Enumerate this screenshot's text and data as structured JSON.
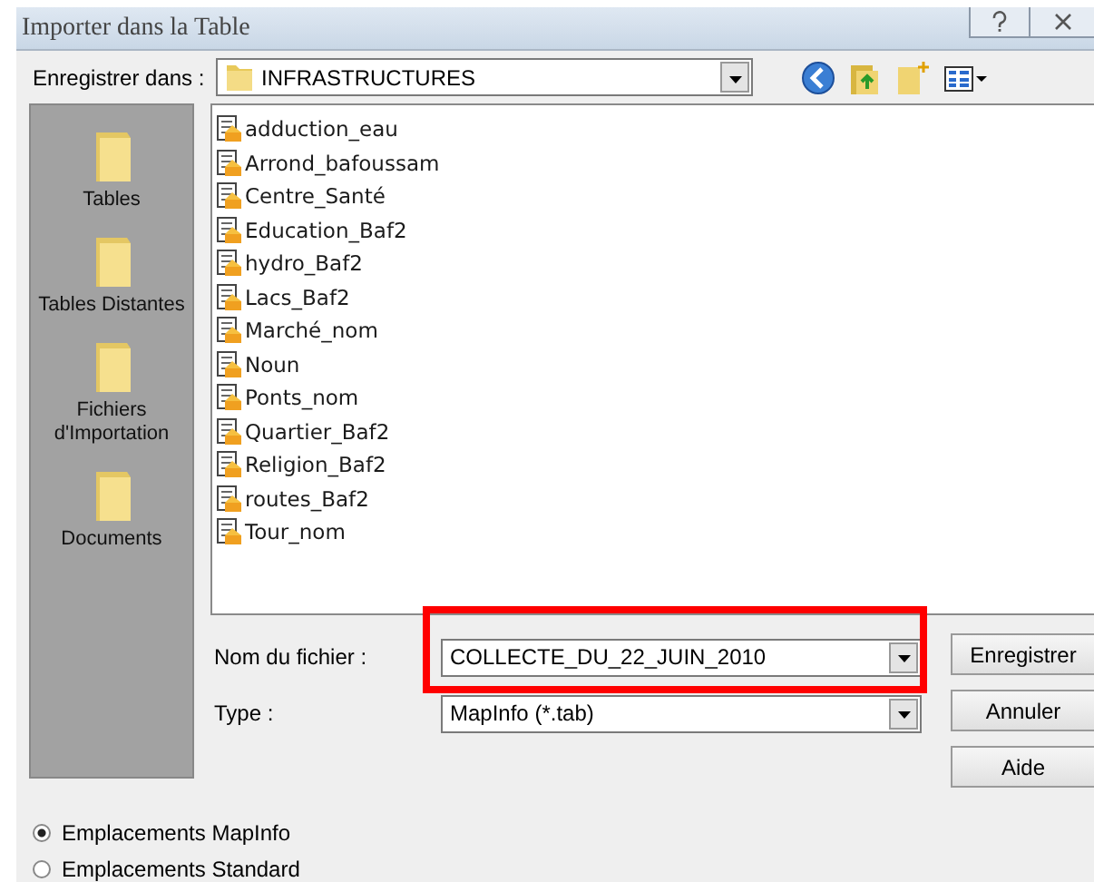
{
  "window": {
    "title": "Importer dans la Table"
  },
  "save_in": {
    "label": "Enregistrer dans :",
    "value": "INFRASTRUCTURES"
  },
  "places": [
    {
      "label": "Tables"
    },
    {
      "label": "Tables Distantes"
    },
    {
      "label": "Fichiers d'Importation"
    },
    {
      "label": "Documents"
    }
  ],
  "files": [
    "adduction_eau",
    "Arrond_bafoussam",
    "Centre_Santé",
    "Education_Baf2",
    "hydro_Baf2",
    "Lacs_Baf2",
    "Marché_nom",
    "Noun",
    "Ponts_nom",
    "Quartier_Baf2",
    "Religion_Baf2",
    "routes_Baf2",
    "Tour_nom"
  ],
  "file_name": {
    "label": "Nom du fichier :",
    "value": "COLLECTE_DU_22_JUIN_2010",
    "highlighted": true
  },
  "file_type": {
    "label": "Type :",
    "value": "MapInfo (*.tab)"
  },
  "buttons": [
    "Enregistrer",
    "Annuler",
    "Aide"
  ],
  "locations": [
    {
      "label": "Emplacements MapInfo",
      "selected": true
    },
    {
      "label": "Emplacements Standard",
      "selected": false
    }
  ]
}
